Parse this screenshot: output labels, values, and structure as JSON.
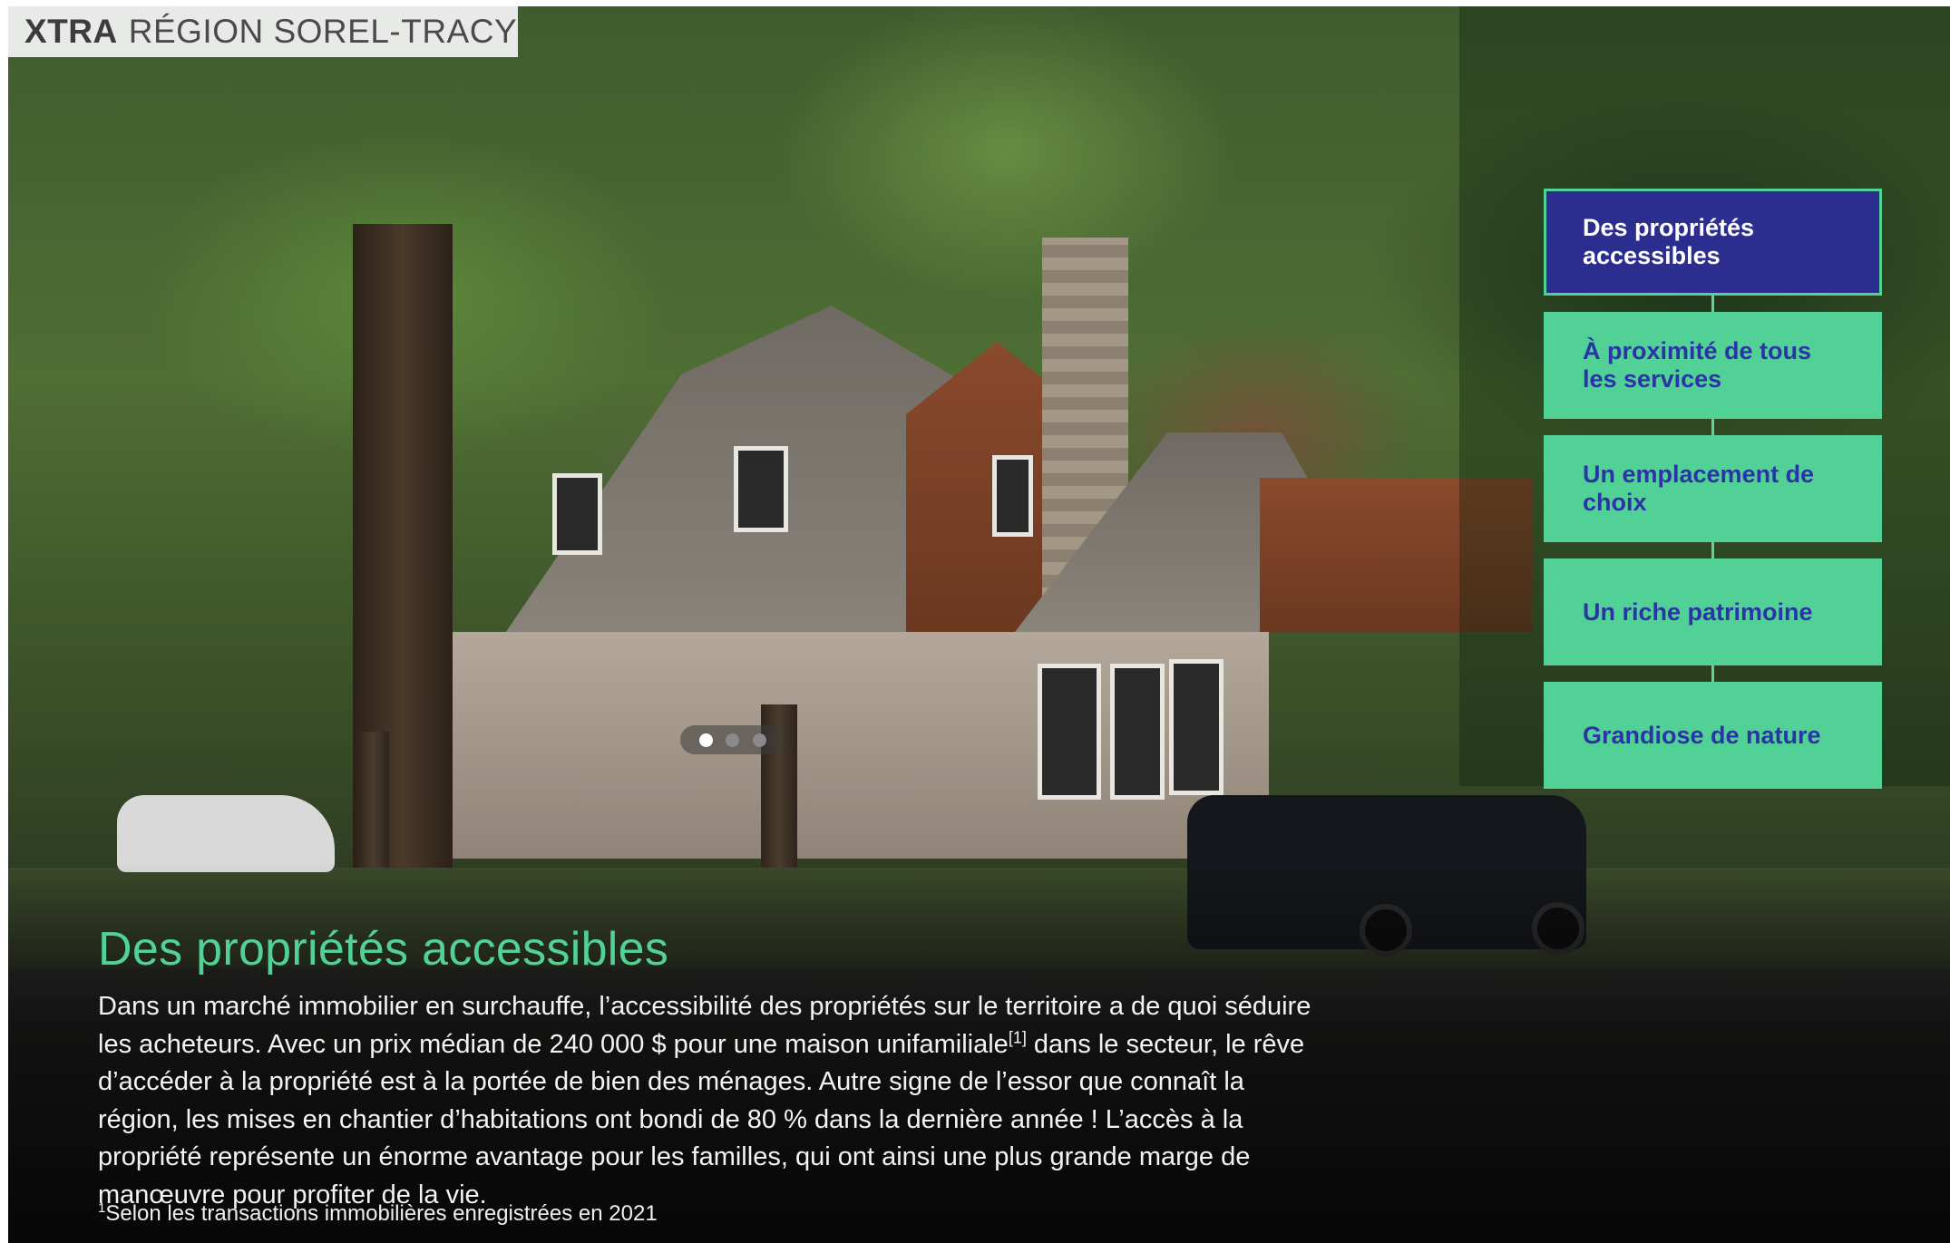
{
  "brand": {
    "name": "XTRA",
    "region": "RÉGION SOREL-TRACY"
  },
  "carousel": {
    "slide_count": 3,
    "active_index": 0
  },
  "side_menu": {
    "items": [
      {
        "label": "Des propriétés accessibles",
        "active": true
      },
      {
        "label": "À proximité de tous les services",
        "active": false
      },
      {
        "label": "Un emplacement de choix",
        "active": false
      },
      {
        "label": "Un riche patrimoine",
        "active": false
      },
      {
        "label": "Grandiose de nature",
        "active": false
      }
    ]
  },
  "content": {
    "title": "Des propriétés accessibles",
    "body_part1": "Dans un marché immobilier en surchauffe, l’accessibilité des propriétés sur le territoire a de quoi séduire les acheteurs. Avec un prix médian de 240 000 $ pour une maison unifamiliale",
    "body_ref": "[1]",
    "body_part2": " dans le secteur, le rêve d’accéder à la propriété est à la portée de bien des ménages. Autre signe de l’essor que connaît la région, les mises en chantier d’habitations ont bondi de 80 % dans la dernière année ! L’accès à la propriété représente un énorme avantage pour les familles, qui ont ainsi une plus grande marge de manœuvre pour profiter de la vie.",
    "footnote_marker": "1",
    "footnote_text": "Selon les transactions immobilières enregistrées en 2021"
  },
  "colors": {
    "accent_green": "#52d196",
    "active_navy": "#2c2e8f",
    "menu_text_blue": "#2a34a6"
  }
}
